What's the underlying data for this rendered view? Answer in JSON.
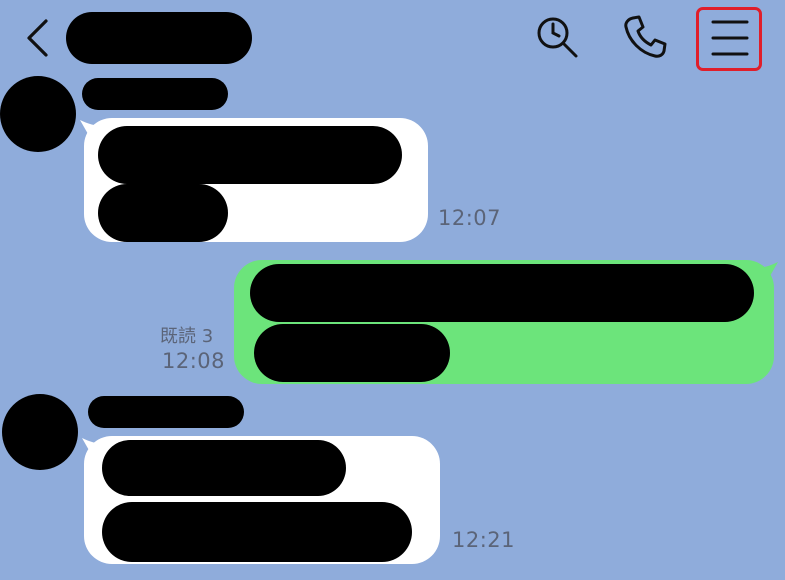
{
  "header": {
    "back_icon": "chevron-left-icon",
    "chat_title": "",
    "search_icon": "search-icon",
    "call_icon": "phone-icon",
    "menu_icon": "hamburger-menu-icon",
    "menu_highlight_color": "#e01e2a"
  },
  "colors": {
    "background": "#8facdb",
    "incoming_bubble": "#ffffff",
    "outgoing_bubble": "#6ce47b",
    "timestamp_text": "#5b6478"
  },
  "messages": [
    {
      "direction": "incoming",
      "sender_name": "",
      "lines": [
        "",
        ""
      ],
      "time": "12:07"
    },
    {
      "direction": "outgoing",
      "lines": [
        "",
        ""
      ],
      "read_status": "既読 3",
      "time": "12:08"
    },
    {
      "direction": "incoming",
      "sender_name": "",
      "lines": [
        "",
        ""
      ],
      "time": "12:21"
    }
  ]
}
